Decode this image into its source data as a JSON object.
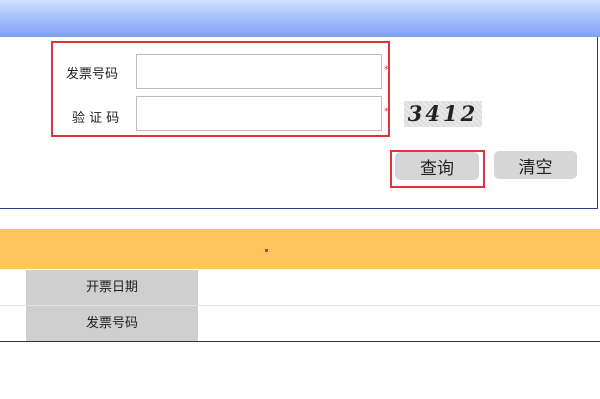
{
  "form": {
    "invoice_number_label": "发票号码",
    "captcha_label": "验 证 码",
    "invoice_number_value": "",
    "captcha_value": "",
    "captcha_image_text": "3412",
    "required_mark": "*"
  },
  "buttons": {
    "query_label": "查询",
    "clear_label": "清空"
  },
  "results": {
    "rows": [
      {
        "label": "开票日期",
        "value": ""
      },
      {
        "label": "发票号码",
        "value": ""
      }
    ]
  },
  "colors": {
    "banner_blue": "#a9c3ff",
    "highlight_red": "#e0333a",
    "results_header_orange": "#fec55c",
    "label_cell_gray": "#cfcfcf",
    "button_gray": "#d6d6d6"
  }
}
